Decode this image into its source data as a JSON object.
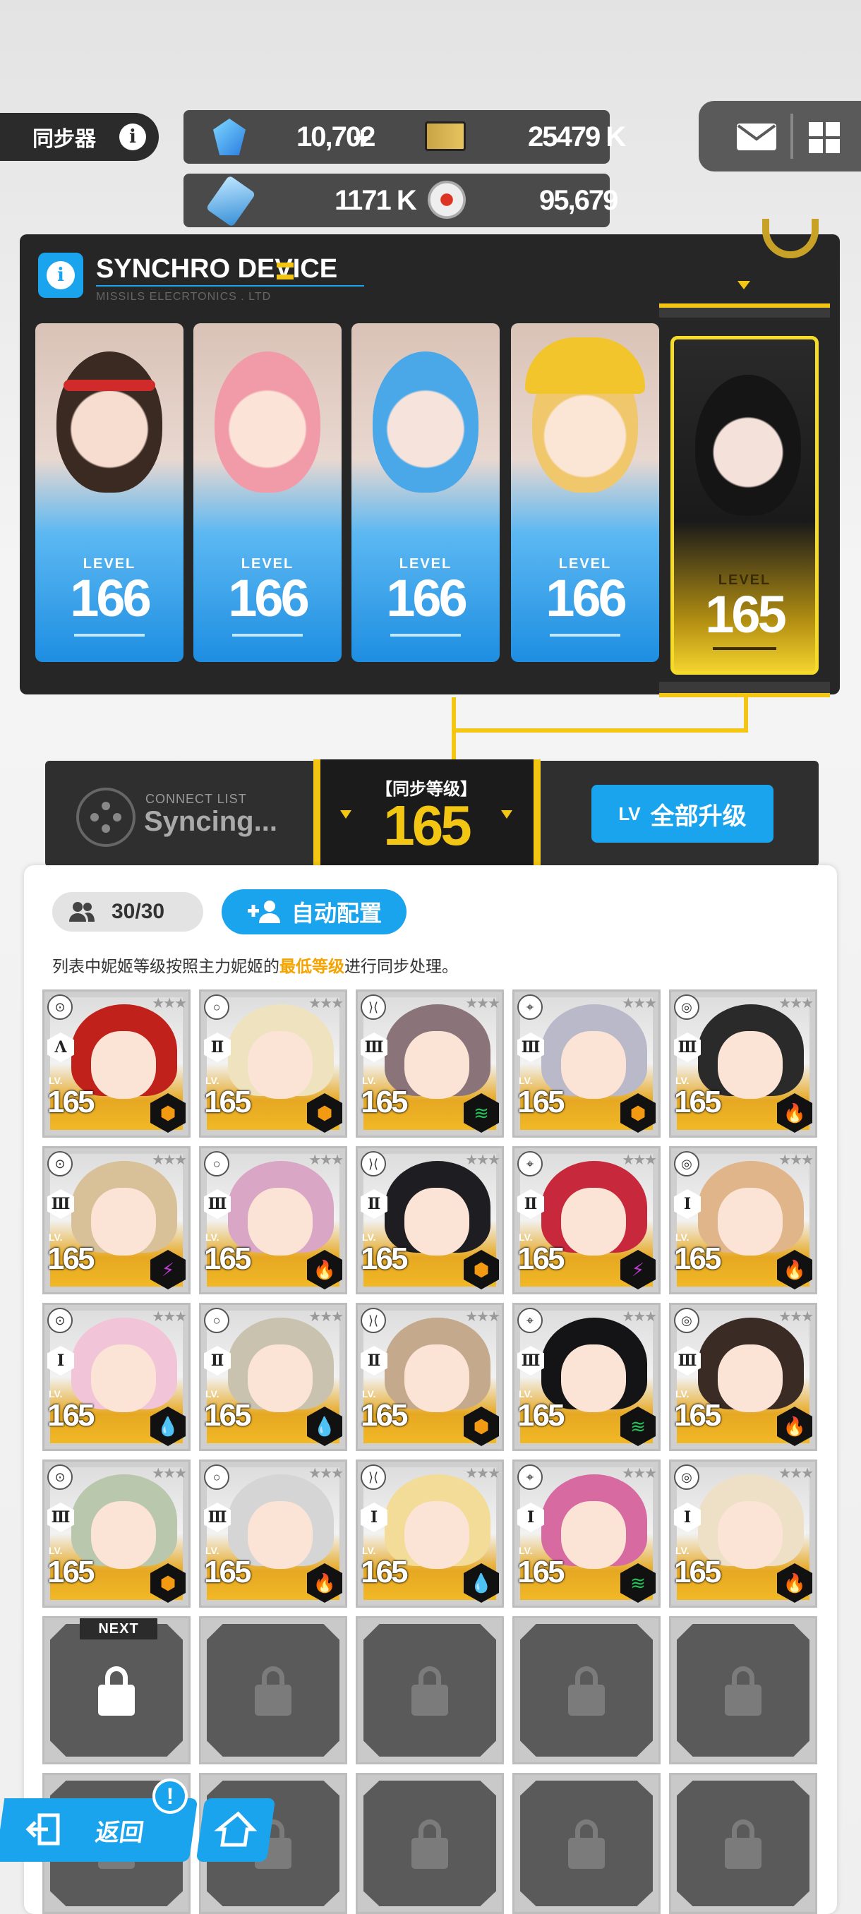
{
  "header": {
    "page_tag": "同步器",
    "info_glyph": "i",
    "resources": [
      {
        "icon": "gem-icon",
        "value": "10,702",
        "plus": "+"
      },
      {
        "icon": "credit-ticket-icon",
        "value": "25479 K"
      },
      {
        "icon": "battle-data-chip-icon",
        "value": "1171 K"
      },
      {
        "icon": "core-dust-orb-icon",
        "value": "95,679"
      }
    ]
  },
  "device": {
    "title": "SYNCHRO DEVICE",
    "subtitle": "MISSILS ELECRTONICS . LTD",
    "level_label": "LEVEL",
    "main_units": [
      {
        "level": "166"
      },
      {
        "level": "166"
      },
      {
        "level": "166"
      },
      {
        "level": "166"
      },
      {
        "level": "165"
      }
    ]
  },
  "connect": {
    "list_label": "CONNECT LIST",
    "status": "Syncing...",
    "sync_level_label": "【同步等级】",
    "sync_level_value": "165",
    "upgrade_all_prefix": "LV",
    "upgrade_all_label": "全部升级"
  },
  "list": {
    "count": "30/30",
    "auto_assign_label": "自动配置",
    "note_before": "列表中妮姬等级按照主力妮姬的",
    "note_highlight": "最低等级",
    "note_after": "进行同步处理。",
    "lv_label": "LV.",
    "slots": [
      {
        "burst": "Λ",
        "level": "165",
        "element": "iron",
        "hair": "#c0211b"
      },
      {
        "burst": "Ⅱ",
        "level": "165",
        "element": "iron",
        "hair": "#efe2bf"
      },
      {
        "burst": "Ⅲ",
        "level": "165",
        "element": "wind",
        "hair": "#8a7379"
      },
      {
        "burst": "Ⅲ",
        "level": "165",
        "element": "iron",
        "hair": "#b9b9c9"
      },
      {
        "burst": "Ⅲ",
        "level": "165",
        "element": "fire",
        "hair": "#2a2a2a"
      },
      {
        "burst": "Ⅲ",
        "level": "165",
        "element": "electric",
        "hair": "#d8c099"
      },
      {
        "burst": "Ⅲ",
        "level": "165",
        "element": "fire",
        "hair": "#d9a6c6"
      },
      {
        "burst": "Ⅱ",
        "level": "165",
        "element": "iron",
        "hair": "#1e1e22"
      },
      {
        "burst": "Ⅱ",
        "level": "165",
        "element": "electric",
        "hair": "#c8283b"
      },
      {
        "burst": "Ⅰ",
        "level": "165",
        "element": "fire",
        "hair": "#e0b58a"
      },
      {
        "burst": "Ⅰ",
        "level": "165",
        "element": "water",
        "hair": "#f2c4d8"
      },
      {
        "burst": "Ⅱ",
        "level": "165",
        "element": "water",
        "hair": "#c9c2ae"
      },
      {
        "burst": "Ⅱ",
        "level": "165",
        "element": "iron",
        "hair": "#c5a98c"
      },
      {
        "burst": "Ⅲ",
        "level": "165",
        "element": "wind",
        "hair": "#141416"
      },
      {
        "burst": "Ⅲ",
        "level": "165",
        "element": "fire",
        "hair": "#3a2b24"
      },
      {
        "burst": "Ⅲ",
        "level": "165",
        "element": "iron",
        "hair": "#b9c7ad"
      },
      {
        "burst": "Ⅲ",
        "level": "165",
        "element": "fire",
        "hair": "#d5d5d5"
      },
      {
        "burst": "Ⅰ",
        "level": "165",
        "element": "water",
        "hair": "#f2dc98"
      },
      {
        "burst": "Ⅰ",
        "level": "165",
        "element": "wind",
        "hair": "#d86aa2"
      },
      {
        "burst": "Ⅰ",
        "level": "165",
        "element": "fire",
        "hair": "#ede0c6"
      }
    ],
    "next_label": "NEXT",
    "locked_slot_count": 10
  },
  "nav": {
    "back_label": "返回",
    "notice_badge": "!"
  },
  "colors": {
    "accent": "#1aa4ee",
    "gold": "#f3c614",
    "dark_panel": "#262626",
    "element_fire": "#d7222b",
    "element_water": "#1c7ee0",
    "element_wind": "#25c35a",
    "element_iron": "#f39a12",
    "element_electric": "#c43bd9"
  }
}
